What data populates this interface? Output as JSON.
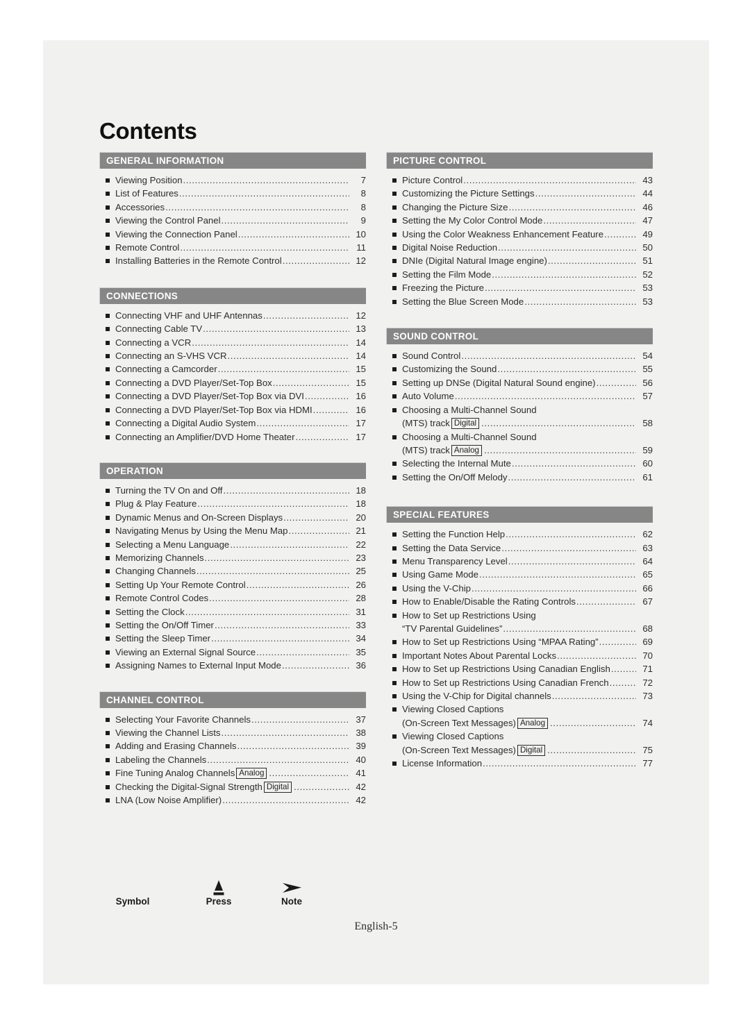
{
  "document": {
    "title": "Contents",
    "footer_page_label": "English-5"
  },
  "legend": {
    "items": [
      {
        "label": "Symbol",
        "icon": "none"
      },
      {
        "label": "Press",
        "icon": "press-button-icon"
      },
      {
        "label": "Note",
        "icon": "note-arrow-icon"
      }
    ]
  },
  "columns": {
    "left": [
      {
        "heading": "GENERAL INFORMATION",
        "entries": [
          {
            "text": "Viewing Position",
            "page": "7"
          },
          {
            "text": "List of Features",
            "page": "8"
          },
          {
            "text": "Accessories",
            "page": "8"
          },
          {
            "text": "Viewing the Control Panel",
            "page": "9"
          },
          {
            "text": "Viewing the Connection Panel",
            "page": "10"
          },
          {
            "text": "Remote Control",
            "page": "11"
          },
          {
            "text": "Installing Batteries in the Remote Control",
            "page": "12"
          }
        ]
      },
      {
        "heading": "CONNECTIONS",
        "entries": [
          {
            "text": "Connecting VHF and UHF Antennas",
            "page": "12"
          },
          {
            "text": "Connecting Cable TV",
            "page": "13"
          },
          {
            "text": "Connecting a VCR",
            "page": "14"
          },
          {
            "text": "Connecting an S-VHS VCR",
            "page": "14"
          },
          {
            "text": "Connecting a Camcorder",
            "page": "15"
          },
          {
            "text": "Connecting a DVD Player/Set-Top Box",
            "page": "15"
          },
          {
            "text": "Connecting a DVD Player/Set-Top Box via DVI",
            "page": "16"
          },
          {
            "text": "Connecting a DVD Player/Set-Top Box via HDMI",
            "page": "16"
          },
          {
            "text": "Connecting a Digital Audio System",
            "page": "17"
          },
          {
            "text": "Connecting an Amplifier/DVD Home Theater",
            "page": "17"
          }
        ]
      },
      {
        "heading": "OPERATION",
        "entries": [
          {
            "text": "Turning the TV On and Off",
            "page": "18"
          },
          {
            "text": "Plug & Play Feature",
            "page": "18"
          },
          {
            "text": "Dynamic Menus and On-Screen Displays",
            "page": "20"
          },
          {
            "text": "Navigating Menus by Using the Menu Map",
            "page": "21"
          },
          {
            "text": "Selecting a Menu Language",
            "page": "22"
          },
          {
            "text": "Memorizing Channels",
            "page": "23"
          },
          {
            "text": "Changing Channels",
            "page": "25"
          },
          {
            "text": "Setting Up Your Remote Control",
            "page": "26"
          },
          {
            "text": "Remote Control Codes",
            "page": "28"
          },
          {
            "text": "Setting the Clock",
            "page": "31"
          },
          {
            "text": "Setting the On/Off Timer",
            "page": "33"
          },
          {
            "text": "Setting the Sleep Timer",
            "page": "34"
          },
          {
            "text": "Viewing an External Signal Source",
            "page": "35"
          },
          {
            "text": "Assigning Names to External Input Mode",
            "page": "36"
          }
        ]
      },
      {
        "heading": "CHANNEL CONTROL",
        "entries": [
          {
            "text": "Selecting Your Favorite Channels",
            "page": "37"
          },
          {
            "text": "Viewing the Channel Lists",
            "page": "38"
          },
          {
            "text": "Adding and Erasing Channels",
            "page": "39"
          },
          {
            "text": "Labeling the Channels",
            "page": "40"
          },
          {
            "text": "Fine Tuning Analog Channels",
            "tag": "Analog",
            "page": "41"
          },
          {
            "text": "Checking the Digital-Signal Strength",
            "tag": "Digital",
            "page": "42"
          },
          {
            "text": "LNA (Low Noise Amplifier)",
            "page": "42"
          }
        ]
      }
    ],
    "right": [
      {
        "heading": "PICTURE CONTROL",
        "entries": [
          {
            "text": "Picture Control",
            "page": "43"
          },
          {
            "text": "Customizing the Picture Settings",
            "page": "44"
          },
          {
            "text": "Changing the Picture Size",
            "page": "46"
          },
          {
            "text": "Setting the My Color Control Mode",
            "page": "47"
          },
          {
            "text": "Using the Color Weakness Enhancement Feature",
            "page": "49"
          },
          {
            "text": "Digital Noise Reduction",
            "page": "50"
          },
          {
            "text": "DNIe (Digital Natural Image engine)",
            "page": "51"
          },
          {
            "text": "Setting the Film Mode",
            "page": "52"
          },
          {
            "text": "Freezing the Picture",
            "page": "53"
          },
          {
            "text": "Setting the Blue Screen Mode",
            "page": "53"
          }
        ]
      },
      {
        "heading": "SOUND CONTROL",
        "entries": [
          {
            "text": "Sound Control",
            "page": "54"
          },
          {
            "text": "Customizing the Sound",
            "page": "55"
          },
          {
            "text": "Setting up DNSe (Digital Natural Sound engine)",
            "page": "56"
          },
          {
            "text": "Auto Volume",
            "page": "57"
          },
          {
            "text": "Choosing a Multi-Channel Sound",
            "cont": "(MTS) track",
            "tag": "Digital",
            "page": "58"
          },
          {
            "text": "Choosing a Multi-Channel Sound",
            "cont": "(MTS) track",
            "tag": "Analog",
            "page": "59"
          },
          {
            "text": "Selecting the Internal Mute",
            "page": "60"
          },
          {
            "text": "Setting the On/Off Melody",
            "page": "61"
          }
        ]
      },
      {
        "heading": "SPECIAL FEATURES",
        "entries": [
          {
            "text": "Setting the Function Help",
            "page": "62"
          },
          {
            "text": "Setting the Data Service",
            "page": "63"
          },
          {
            "text": "Menu Transparency Level",
            "page": "64"
          },
          {
            "text": "Using Game Mode",
            "page": "65"
          },
          {
            "text": "Using the V-Chip",
            "page": "66"
          },
          {
            "text": "How to Enable/Disable the Rating Controls",
            "page": "67"
          },
          {
            "text": "How to Set up Restrictions Using",
            "cont": "“TV Parental Guidelines”",
            "page": "68"
          },
          {
            "text": "How to Set up Restrictions Using “MPAA Rating”",
            "page": "69"
          },
          {
            "text": "Important Notes About Parental Locks",
            "page": "70"
          },
          {
            "text": "How to Set up Restrictions Using Canadian English",
            "page": "71"
          },
          {
            "text": "How to Set up Restrictions Using Canadian French",
            "page": "72"
          },
          {
            "text": "Using the V-Chip for Digital channels",
            "page": "73"
          },
          {
            "text": "Viewing Closed Captions",
            "cont": "(On-Screen Text Messages)",
            "tag": "Analog",
            "page": "74"
          },
          {
            "text": "Viewing Closed Captions",
            "cont": "(On-Screen Text Messages)",
            "tag": "Digital",
            "page": "75"
          },
          {
            "text": "License Information",
            "page": "77"
          }
        ]
      }
    ]
  }
}
